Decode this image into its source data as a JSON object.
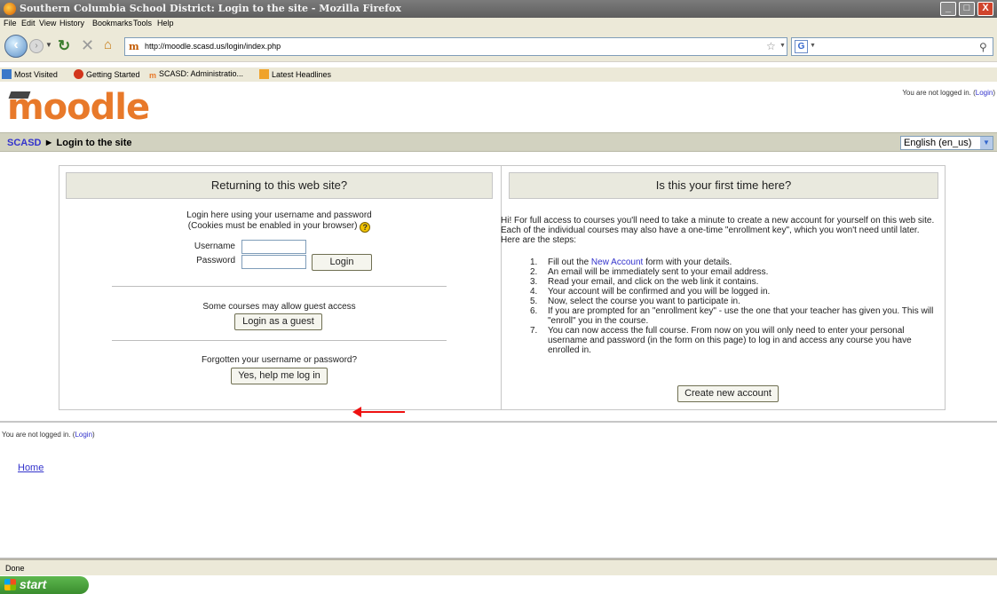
{
  "window": {
    "title": "Southern Columbia School District: Login to the site - Mozilla Firefox",
    "controls": {
      "minimize": "_",
      "maximize": "□",
      "close": "X"
    }
  },
  "menu": [
    "File",
    "Edit",
    "View",
    "History",
    "Bookmarks",
    "Tools",
    "Help"
  ],
  "nav": {
    "url": "http://moodle.scasd.us/login/index.php",
    "search_placeholder": "",
    "search_engine_label": "G"
  },
  "bookmarks": [
    {
      "label": "Most Visited",
      "icon": "bookmark-icon",
      "color": "#3a78c9"
    },
    {
      "label": "Getting Started",
      "icon": "firefox-icon",
      "color": "#d2351c"
    },
    {
      "label": "SCASD: Administratio...",
      "icon": "moodle-icon",
      "color": "#e8792a"
    },
    {
      "label": "Latest Headlines",
      "icon": "rss-icon",
      "color": "#f0a32b"
    }
  ],
  "page": {
    "logo": "moodle",
    "login_info": {
      "text": "You are not logged in. (",
      "link": "Login",
      "close": ")"
    },
    "breadcrumb": {
      "home": "SCASD",
      "separator": "►",
      "current": "Login to the site"
    },
    "language": "English (en_us)",
    "left_panel": {
      "heading": "Returning to this web site?",
      "line1": "Login here using your username and password",
      "line2": "(Cookies must be enabled in your browser)",
      "username_label": "Username",
      "password_label": "Password",
      "login_button": "Login",
      "guest_text": "Some courses may allow guest access",
      "guest_button": "Login as a guest",
      "forgot_text": "Forgotten your username or password?",
      "forgot_button": "Yes, help me log in"
    },
    "right_panel": {
      "heading": "Is this your first time here?",
      "intro": "Hi! For full access to courses you'll need to take a minute to create a new account for yourself on this web site. Each of the individual courses may also have a one-time \"enrollment key\", which you won't need until later. Here are the steps:",
      "steps": [
        {
          "num": "1.",
          "before": "Fill out the ",
          "link": "New Account",
          "after": " form with your details."
        },
        {
          "num": "2.",
          "before": "An email will be immediately sent to your email address.",
          "link": "",
          "after": ""
        },
        {
          "num": "3.",
          "before": "Read your email, and click on the web link it contains.",
          "link": "",
          "after": ""
        },
        {
          "num": "4.",
          "before": "Your account will be confirmed and you will be logged in.",
          "link": "",
          "after": ""
        },
        {
          "num": "5.",
          "before": "Now, select the course you want to participate in.",
          "link": "",
          "after": ""
        },
        {
          "num": "6.",
          "before": "If you are prompted for an \"enrollment key\" - use the one that your teacher has given you. This will \"enroll\" you in the course.",
          "link": "",
          "after": ""
        },
        {
          "num": "7.",
          "before": "You can now access the full course. From now on you will only need to enter your personal username and password (in the form on this page) to log in and access any course you have enrolled in.",
          "link": "",
          "after": ""
        }
      ],
      "create_button": "Create new account"
    },
    "footer_login": {
      "text": "You are not logged in. (",
      "link": "Login",
      "close": ")"
    },
    "home_link": "Home"
  },
  "status": "Done",
  "taskbar": {
    "start": "start"
  },
  "colors": {
    "accent_arrow": "#ee1111",
    "link": "#3333cc",
    "logo": "#e8792a"
  }
}
